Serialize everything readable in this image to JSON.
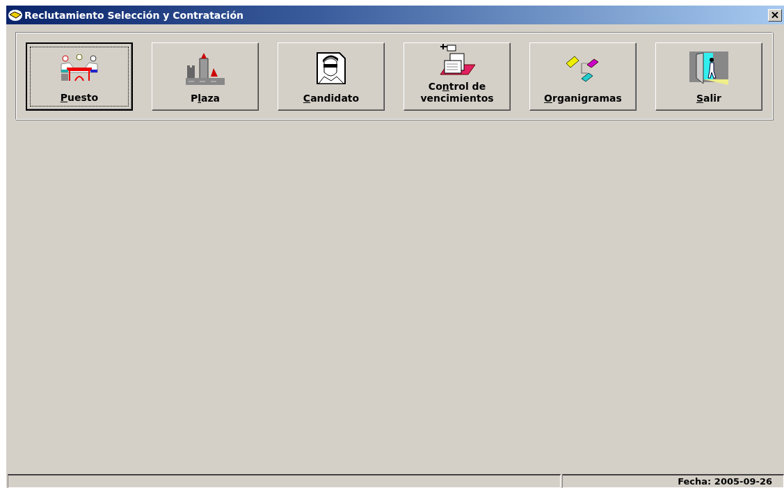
{
  "window": {
    "title": "Reclutamiento Selección y Contratación"
  },
  "toolbar": {
    "buttons": [
      {
        "kind": "meeting",
        "label_parts": [
          {
            "text": "P",
            "underlined": true
          },
          {
            "text": "uesto",
            "underlined": false
          }
        ],
        "focused": true
      },
      {
        "kind": "castle",
        "label_parts": [
          {
            "text": "P",
            "underlined": false
          },
          {
            "text": "l",
            "underlined": true
          },
          {
            "text": "aza",
            "underlined": false
          }
        ],
        "focused": false
      },
      {
        "kind": "person",
        "label_parts": [
          {
            "text": "C",
            "underlined": true
          },
          {
            "text": "andidato",
            "underlined": false
          }
        ],
        "focused": false
      },
      {
        "kind": "papers",
        "label_parts": [
          {
            "text": "Co",
            "underlined": false
          },
          {
            "text": "n",
            "underlined": true
          },
          {
            "text": "trol de vencimientos",
            "underlined": false
          }
        ],
        "focused": false
      },
      {
        "kind": "org",
        "label_parts": [
          {
            "text": "O",
            "underlined": true
          },
          {
            "text": "rganigramas",
            "underlined": false
          }
        ],
        "focused": false
      },
      {
        "kind": "exit",
        "label_parts": [
          {
            "text": "S",
            "underlined": true
          },
          {
            "text": "alir",
            "underlined": false
          }
        ],
        "focused": false
      }
    ]
  },
  "status_bar": {
    "date": "Fecha: 2005-09-26"
  }
}
